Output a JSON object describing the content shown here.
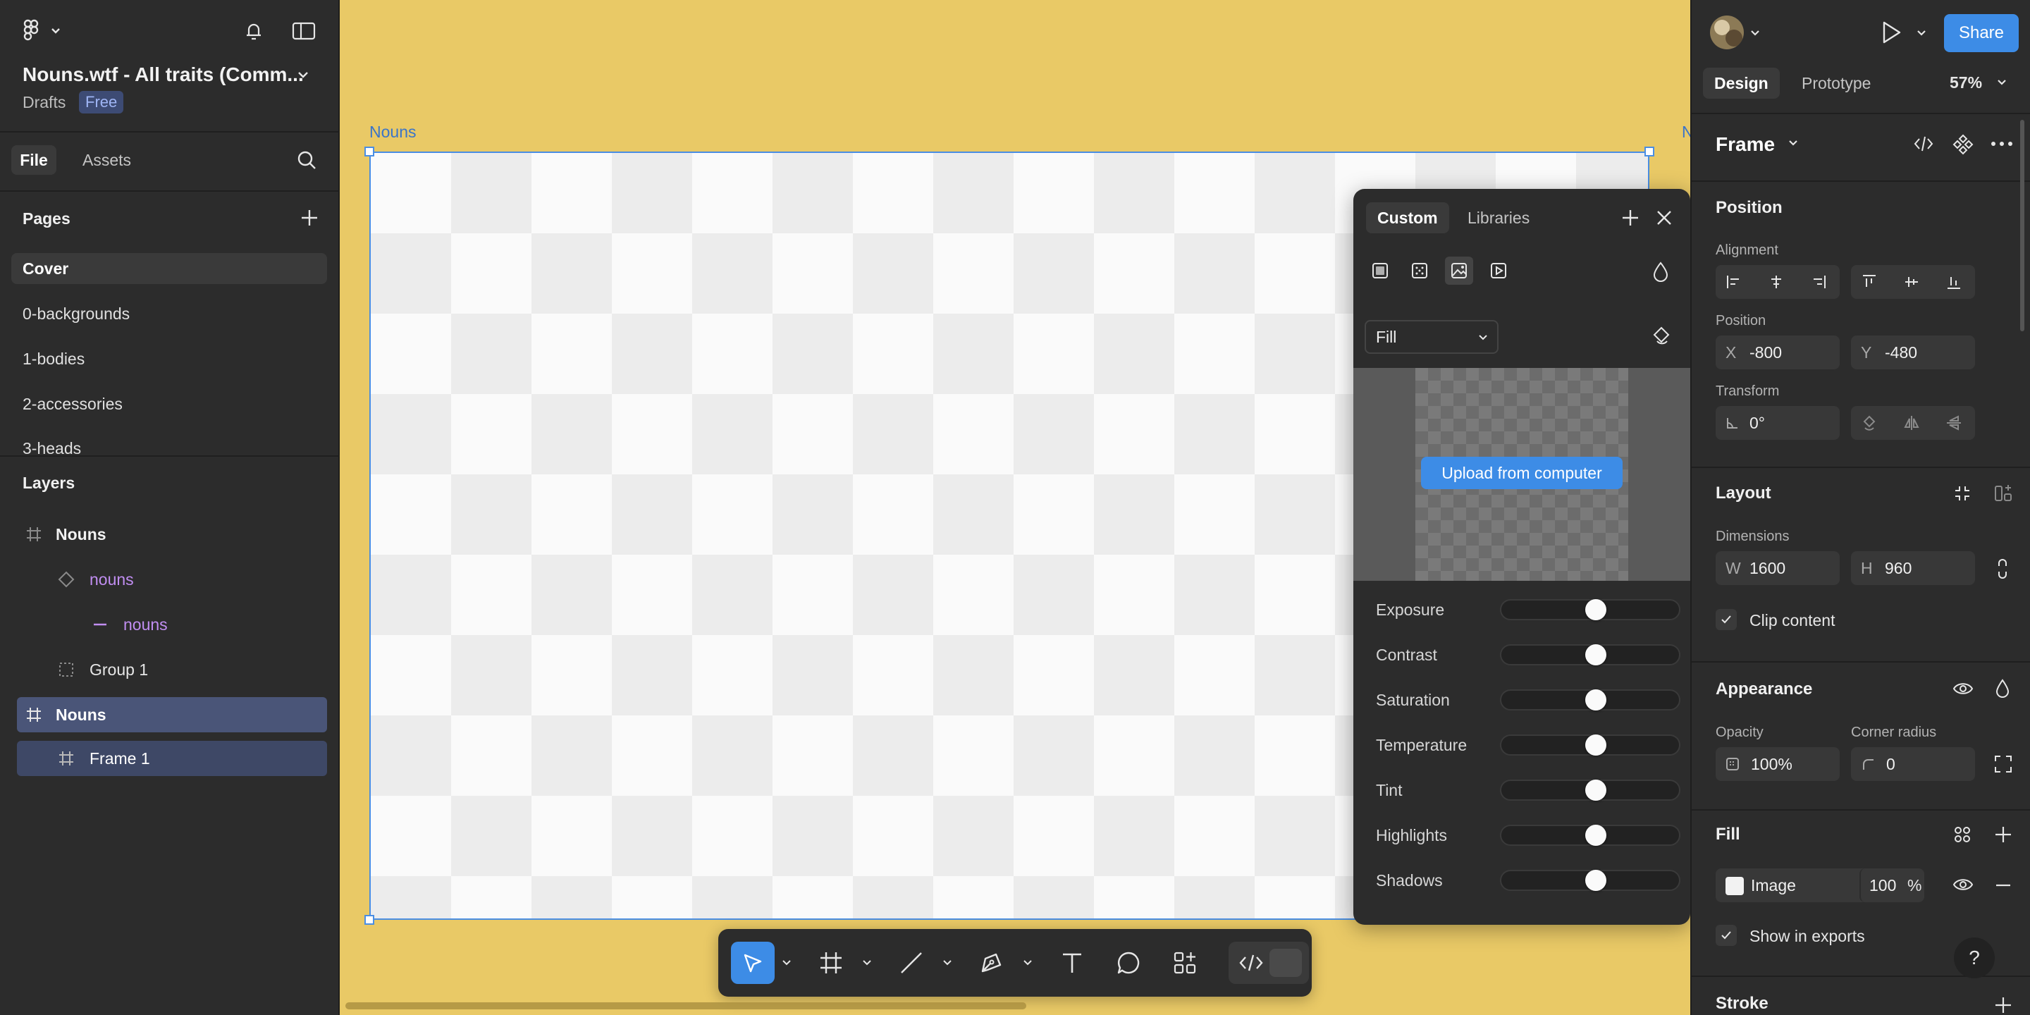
{
  "left_panel": {
    "file_name": "Nouns.wtf - All traits (Comm...",
    "location": "Drafts",
    "plan_badge": "Free",
    "tabs": {
      "file": "File",
      "assets": "Assets"
    },
    "pages_header": "Pages",
    "pages": [
      {
        "label": "Cover",
        "active": true
      },
      {
        "label": "0-backgrounds"
      },
      {
        "label": "1-bodies"
      },
      {
        "label": "2-accessories"
      },
      {
        "label": "3-heads"
      }
    ],
    "layers_header": "Layers",
    "layers": [
      {
        "label": "Nouns",
        "icon": "frame-icon"
      },
      {
        "label": "nouns",
        "icon": "component-icon"
      },
      {
        "label": "nouns",
        "icon": "line-icon"
      },
      {
        "label": "Group 1",
        "icon": "group-icon"
      },
      {
        "label": "Nouns",
        "icon": "frame-icon",
        "selected": true
      },
      {
        "label": "Frame 1",
        "icon": "frame-icon",
        "selected": true
      }
    ]
  },
  "canvas": {
    "background": "#e9c966",
    "frame_label": "Nouns",
    "frame_label_2": "N"
  },
  "image_fill_popover": {
    "tabs": {
      "custom": "Custom",
      "libraries": "Libraries"
    },
    "fill_mode": "Fill",
    "upload_label": "Upload from computer",
    "adjustments": [
      {
        "label": "Exposure",
        "value": 0
      },
      {
        "label": "Contrast",
        "value": 0
      },
      {
        "label": "Saturation",
        "value": 0
      },
      {
        "label": "Temperature",
        "value": 0
      },
      {
        "label": "Tint",
        "value": 0
      },
      {
        "label": "Highlights",
        "value": 0
      },
      {
        "label": "Shadows",
        "value": 0
      }
    ]
  },
  "toolbar": {
    "tools": [
      "move-tool",
      "frame-tool",
      "line-tool",
      "pen-tool",
      "text-tool",
      "comment-tool",
      "actions-tool",
      "dev-mode-toggle"
    ]
  },
  "right_panel": {
    "share_label": "Share",
    "tabs": {
      "design": "Design",
      "prototype": "Prototype"
    },
    "zoom": "57%",
    "selection_type": "Frame",
    "position": {
      "header": "Position",
      "alignment_label": "Alignment",
      "position_label": "Position",
      "x_key": "X",
      "x": "-800",
      "y_key": "Y",
      "y": "-480",
      "transform_label": "Transform",
      "rotation": "0°"
    },
    "layout": {
      "header": "Layout",
      "dimensions_label": "Dimensions",
      "w_key": "W",
      "w": "1600",
      "h_key": "H",
      "h": "960",
      "clip_content": "Clip content"
    },
    "appearance": {
      "header": "Appearance",
      "opacity_label": "Opacity",
      "opacity": "100%",
      "corner_radius_label": "Corner radius",
      "corner_radius": "0"
    },
    "fill": {
      "header": "Fill",
      "type": "Image",
      "opacity": "100",
      "unit": "%",
      "show_in_exports": "Show in exports"
    },
    "stroke": {
      "header": "Stroke"
    },
    "help": "?"
  },
  "colors": {
    "accent": "#3d8ce6",
    "panel": "#2c2c2c",
    "selection": "#4a8ee3",
    "component": "#c18ef2"
  }
}
